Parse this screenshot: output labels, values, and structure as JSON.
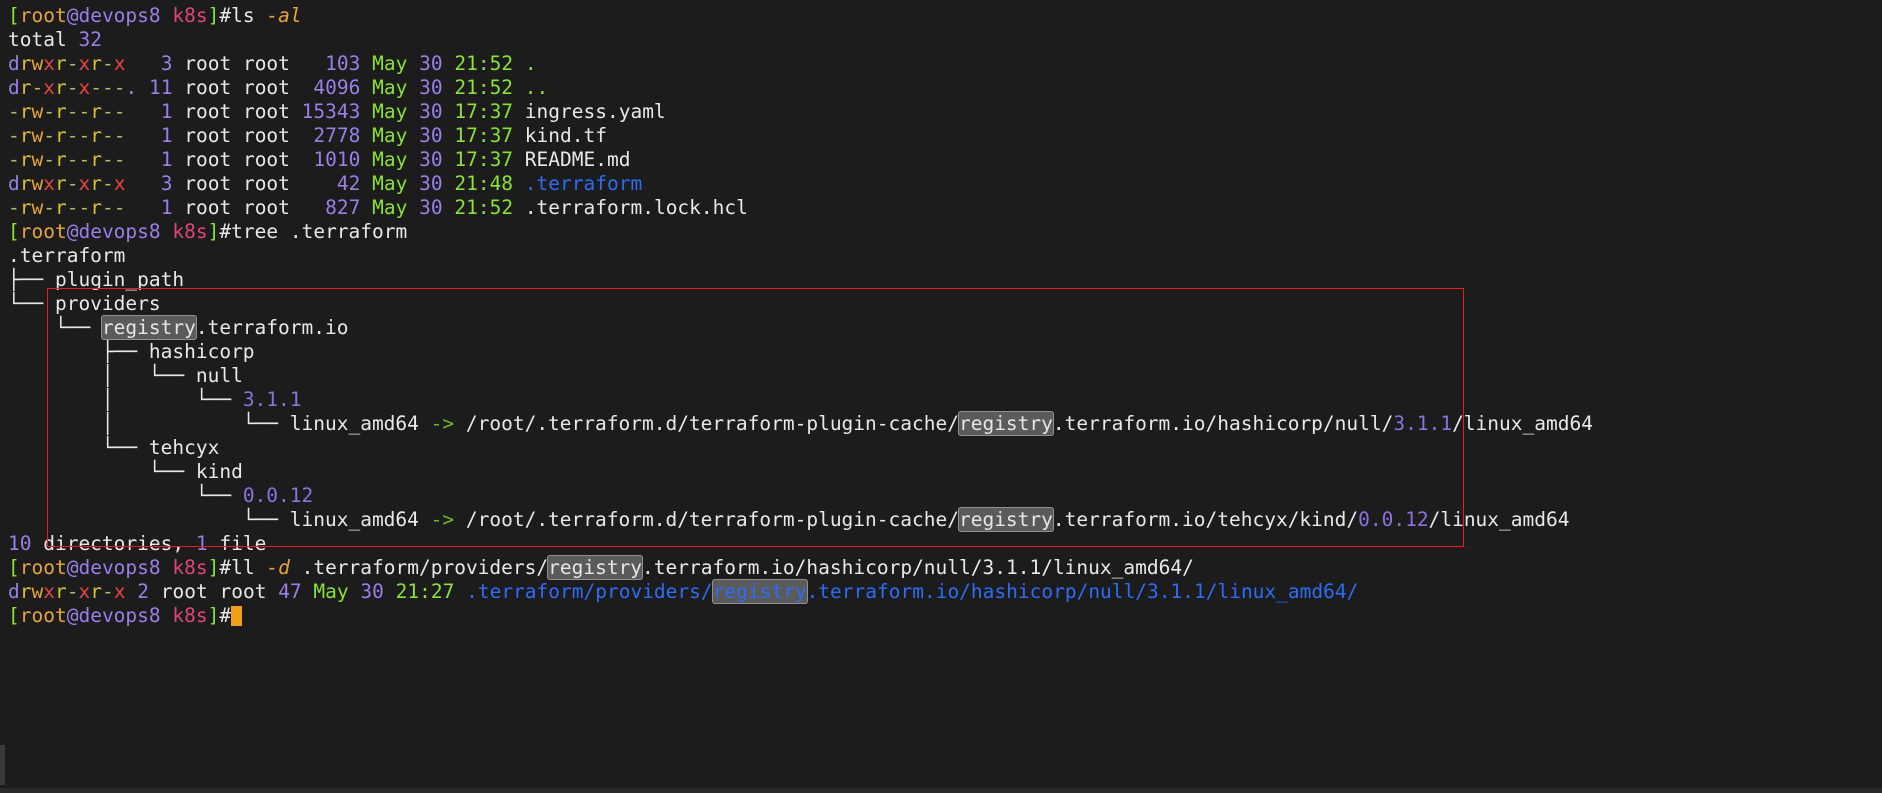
{
  "terminal": {
    "title": "root@devops8:~/k8s",
    "background_color": "#1c1c1c",
    "foreground_color": "#e8e8e8",
    "cursor_color": "#f0a016",
    "highlight_color": "#5b5b5b",
    "annotation_color": "#e02020"
  },
  "prompt": {
    "bracket_open": "[",
    "user": "root",
    "at_host": "@devops8",
    "cwd": "k8s",
    "bracket_close": "]",
    "sigil": "#"
  },
  "commands": {
    "cmd1_name": "ls",
    "cmd1_flag": "-al",
    "cmd2_name": "tree",
    "cmd2_arg": ".terraform",
    "cmd3_name": "ll",
    "cmd3_flag": "-d",
    "cmd3_arg_pre": " .terraform/providers/",
    "cmd3_arg_hl": "registry",
    "cmd3_arg_post": ".terraform.io/hashicorp/null/3.1.1/linux_amd64/"
  },
  "ls_output": {
    "total_label": "total",
    "total_value": "32",
    "rows": [
      {
        "perm": "drwxr-xr-x",
        "links": "3",
        "owner": "root",
        "group": "root",
        "size": "103",
        "month": "May",
        "day": "30",
        "time": "21:52",
        "name": ".",
        "name_color": "green"
      },
      {
        "perm": "dr-xr-x---.",
        "links": "11",
        "owner": "root",
        "group": "root",
        "size": "4096",
        "month": "May",
        "day": "30",
        "time": "21:52",
        "name": "..",
        "name_color": "green"
      },
      {
        "perm": "-rw-r--r--",
        "links": "1",
        "owner": "root",
        "group": "root",
        "size": "15343",
        "month": "May",
        "day": "30",
        "time": "17:37",
        "name": "ingress.yaml",
        "name_color": "white"
      },
      {
        "perm": "-rw-r--r--",
        "links": "1",
        "owner": "root",
        "group": "root",
        "size": "2778",
        "month": "May",
        "day": "30",
        "time": "17:37",
        "name": "kind.tf",
        "name_color": "white"
      },
      {
        "perm": "-rw-r--r--",
        "links": "1",
        "owner": "root",
        "group": "root",
        "size": "1010",
        "month": "May",
        "day": "30",
        "time": "17:37",
        "name": "README.md",
        "name_color": "white"
      },
      {
        "perm": "drwxr-xr-x",
        "links": "3",
        "owner": "root",
        "group": "root",
        "size": "42",
        "month": "May",
        "day": "30",
        "time": "21:48",
        "name": ".terraform",
        "name_color": "blue"
      },
      {
        "perm": "-rw-r--r--",
        "links": "1",
        "owner": "root",
        "group": "root",
        "size": "827",
        "month": "May",
        "day": "30",
        "time": "21:52",
        "name": ".terraform.lock.hcl",
        "name_color": "white"
      }
    ]
  },
  "tree_output": {
    "root": ".terraform",
    "node_plugin_path_branch": "├── ",
    "node_plugin_path": "plugin_path",
    "node_providers_branch": "└── ",
    "node_providers": "providers",
    "node_registry_branch": "    └── ",
    "node_registry_hl": "registry",
    "node_registry_rest": ".terraform.io",
    "node_hashicorp_branch": "        ├── ",
    "node_hashicorp": "hashicorp",
    "node_null_branch": "        │   └── ",
    "node_null": "null",
    "node_null_ver_branch": "        │       └── ",
    "node_null_ver": "3.1.1",
    "node_null_link_branch": "        │           └── ",
    "node_null_link_name": "linux_amd64",
    "arrow": " -> ",
    "node_null_link_pre": "/root/.terraform.d/terraform-plugin-cache/",
    "node_null_link_hl": "registry",
    "node_null_link_post": ".terraform.io/hashicorp/null/",
    "node_null_link_ver": "3.1.1",
    "node_null_link_tail": "/linux_amd64",
    "node_tehcyx_branch": "        └── ",
    "node_tehcyx": "tehcyx",
    "node_kind_branch": "            └── ",
    "node_kind": "kind",
    "node_kind_ver_branch": "                └── ",
    "node_kind_ver": "0.0.12",
    "node_kind_link_branch": "                    └── ",
    "node_kind_link_name": "linux_amd64",
    "node_kind_link_pre": "/root/.terraform.d/terraform-plugin-cache/",
    "node_kind_link_hl": "registry",
    "node_kind_link_post": ".terraform.io/tehcyx/kind/",
    "node_kind_link_ver": "0.0.12",
    "node_kind_link_tail": "/linux_amd64",
    "summary_dirs_count": "10",
    "summary_dirs_label": " directories, ",
    "summary_files_count": "1",
    "summary_files_label": " file"
  },
  "ll_output": {
    "perm": "drwxr-xr-x",
    "links": "2",
    "owner": "root",
    "group": "root",
    "size": "47",
    "month": "May",
    "day": "30",
    "time": "21:27",
    "path_pre": ".terraform/providers/",
    "path_hl": "registry",
    "path_post": ".terraform.io/hashicorp/null/3.1.1/linux_amd64/"
  }
}
